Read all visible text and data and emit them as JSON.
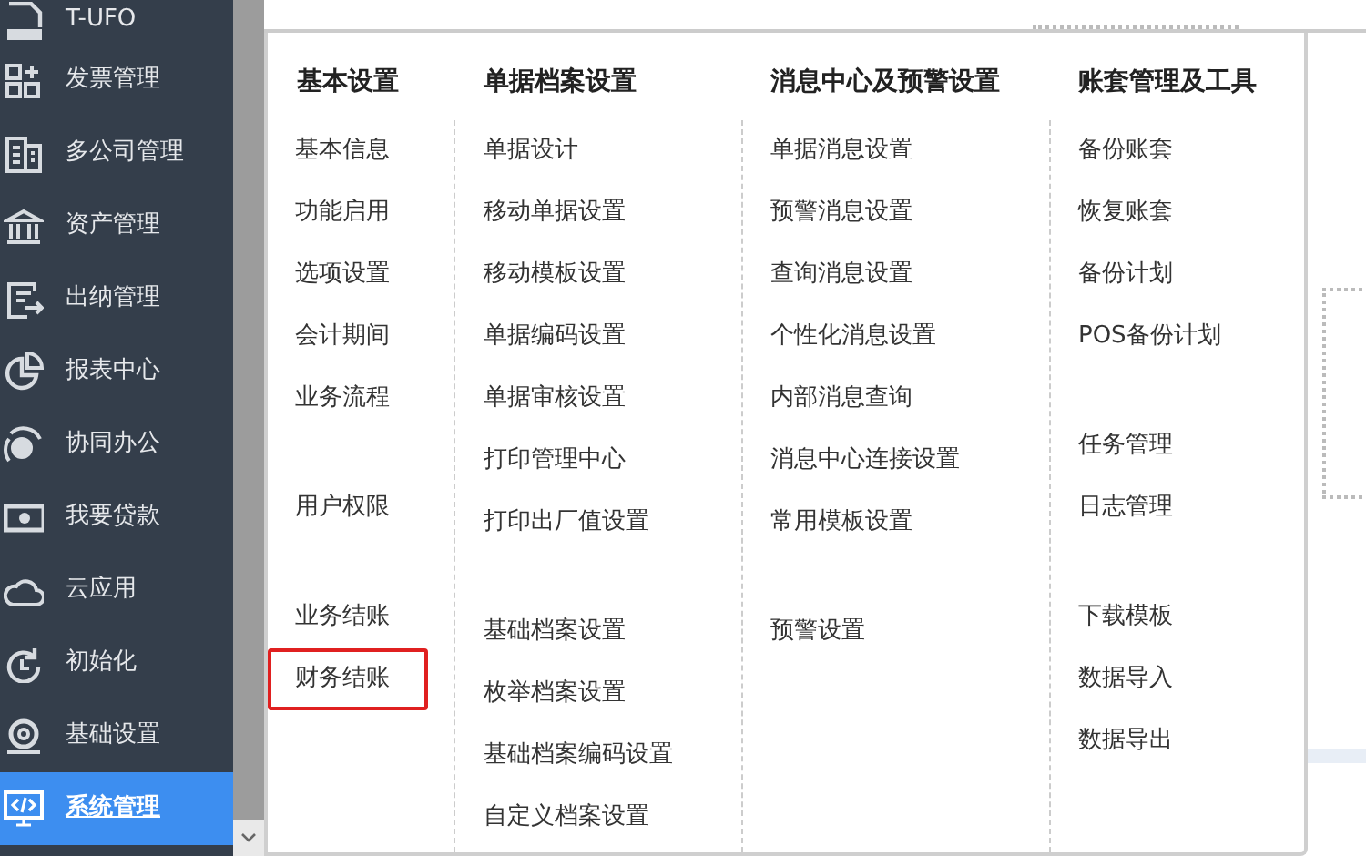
{
  "sidebar": {
    "items": [
      {
        "label": "T-UFO",
        "selected": false
      },
      {
        "label": "发票管理",
        "selected": false
      },
      {
        "label": "多公司管理",
        "selected": false
      },
      {
        "label": "资产管理",
        "selected": false
      },
      {
        "label": "出纳管理",
        "selected": false
      },
      {
        "label": "报表中心",
        "selected": false
      },
      {
        "label": "协同办公",
        "selected": false
      },
      {
        "label": "我要贷款",
        "selected": false
      },
      {
        "label": "云应用",
        "selected": false
      },
      {
        "label": "初始化",
        "selected": false
      },
      {
        "label": "基础设置",
        "selected": false
      },
      {
        "label": "系统管理",
        "selected": true
      }
    ]
  },
  "menu": {
    "columns": [
      {
        "title": "基本设置",
        "groups": [
          [
            {
              "label": "基本信息",
              "highlighted": false
            },
            {
              "label": "功能启用",
              "highlighted": false
            },
            {
              "label": "选项设置",
              "highlighted": false
            },
            {
              "label": "会计期间",
              "highlighted": false
            },
            {
              "label": "业务流程",
              "highlighted": false
            }
          ],
          [
            {
              "label": "用户权限",
              "highlighted": false
            }
          ],
          [
            {
              "label": "业务结账",
              "highlighted": false
            },
            {
              "label": "财务结账",
              "highlighted": true
            }
          ]
        ]
      },
      {
        "title": "单据档案设置",
        "groups": [
          [
            {
              "label": "单据设计",
              "highlighted": false
            },
            {
              "label": "移动单据设置",
              "highlighted": false
            },
            {
              "label": "移动模板设置",
              "highlighted": false
            },
            {
              "label": "单据编码设置",
              "highlighted": false
            },
            {
              "label": "单据审核设置",
              "highlighted": false
            },
            {
              "label": "打印管理中心",
              "highlighted": false
            },
            {
              "label": "打印出厂值设置",
              "highlighted": false
            }
          ],
          [
            {
              "label": "基础档案设置",
              "highlighted": false
            },
            {
              "label": "枚举档案设置",
              "highlighted": false
            },
            {
              "label": "基础档案编码设置",
              "highlighted": false
            },
            {
              "label": "自定义档案设置",
              "highlighted": false
            }
          ]
        ]
      },
      {
        "title": "消息中心及预警设置",
        "groups": [
          [
            {
              "label": "单据消息设置",
              "highlighted": false
            },
            {
              "label": "预警消息设置",
              "highlighted": false
            },
            {
              "label": "查询消息设置",
              "highlighted": false
            },
            {
              "label": "个性化消息设置",
              "highlighted": false
            },
            {
              "label": "内部消息查询",
              "highlighted": false
            },
            {
              "label": "消息中心连接设置",
              "highlighted": false
            },
            {
              "label": "常用模板设置",
              "highlighted": false
            }
          ],
          [
            {
              "label": "预警设置",
              "highlighted": false
            }
          ]
        ]
      },
      {
        "title": "账套管理及工具",
        "groups": [
          [
            {
              "label": "备份账套",
              "highlighted": false
            },
            {
              "label": "恢复账套",
              "highlighted": false
            },
            {
              "label": "备份计划",
              "highlighted": false
            },
            {
              "label": "POS备份计划",
              "highlighted": false
            }
          ],
          [
            {
              "label": "任务管理",
              "highlighted": false
            },
            {
              "label": "日志管理",
              "highlighted": false
            }
          ],
          [
            {
              "label": "下载模板",
              "highlighted": false
            },
            {
              "label": "数据导入",
              "highlighted": false
            },
            {
              "label": "数据导出",
              "highlighted": false
            }
          ]
        ]
      }
    ]
  }
}
